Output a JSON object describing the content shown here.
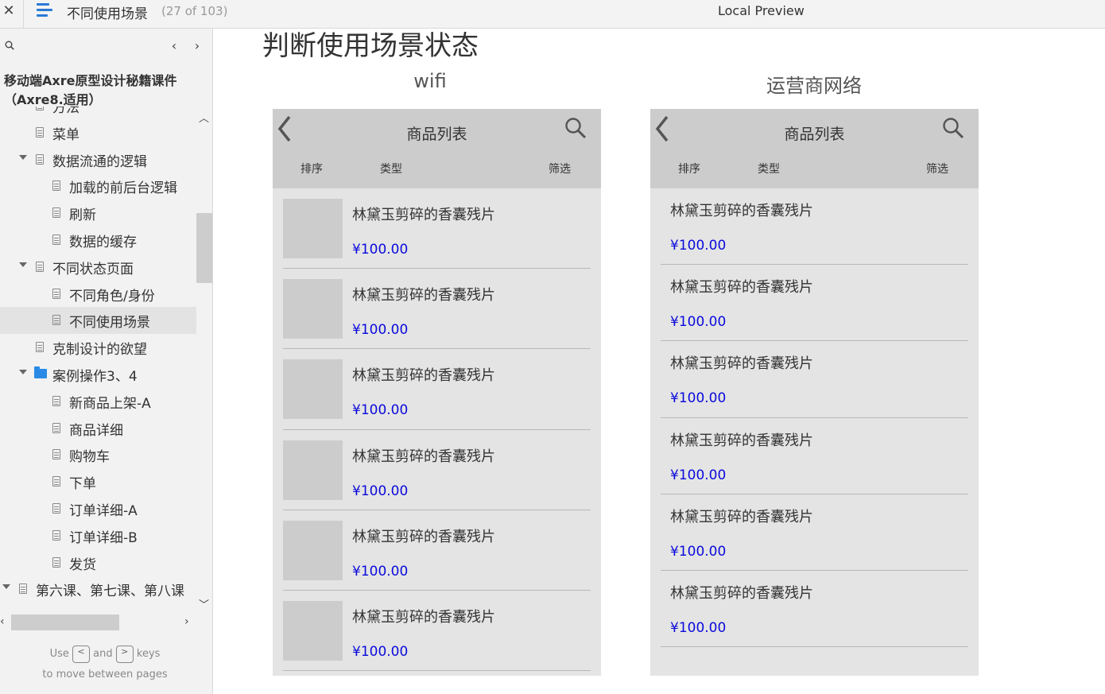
{
  "topbar": {
    "close": "✕",
    "page_title": "不同使用场景",
    "page_count": "(27 of 103)",
    "preview_label": "Local Preview"
  },
  "sidebar": {
    "prev": "‹",
    "next": "›",
    "project_title": "移动端Axre原型设计秘籍课件（Axre8.适用）",
    "tree": [
      {
        "label": "方法",
        "type": "page",
        "level": 1,
        "expanded": false,
        "selected": false
      },
      {
        "label": "菜单",
        "type": "page",
        "level": 1,
        "expanded": false,
        "selected": false
      },
      {
        "label": "数据流通的逻辑",
        "type": "page",
        "level": 1,
        "expanded": true,
        "selected": false
      },
      {
        "label": "加载的前后台逻辑",
        "type": "page",
        "level": 2,
        "expanded": false,
        "selected": false
      },
      {
        "label": "刷新",
        "type": "page",
        "level": 2,
        "expanded": false,
        "selected": false
      },
      {
        "label": "数据的缓存",
        "type": "page",
        "level": 2,
        "expanded": false,
        "selected": false
      },
      {
        "label": "不同状态页面",
        "type": "page",
        "level": 1,
        "expanded": true,
        "selected": false
      },
      {
        "label": "不同角色/身份",
        "type": "page",
        "level": 2,
        "expanded": false,
        "selected": false
      },
      {
        "label": "不同使用场景",
        "type": "page",
        "level": 2,
        "expanded": false,
        "selected": true
      },
      {
        "label": "克制设计的欲望",
        "type": "page",
        "level": 1,
        "expanded": false,
        "selected": false
      },
      {
        "label": "案例操作3、4",
        "type": "folder",
        "level": 1,
        "expanded": true,
        "selected": false
      },
      {
        "label": "新商品上架-A",
        "type": "page",
        "level": 2,
        "expanded": false,
        "selected": false
      },
      {
        "label": "商品详细",
        "type": "page",
        "level": 2,
        "expanded": false,
        "selected": false
      },
      {
        "label": "购物车",
        "type": "page",
        "level": 2,
        "expanded": false,
        "selected": false
      },
      {
        "label": "下单",
        "type": "page",
        "level": 2,
        "expanded": false,
        "selected": false
      },
      {
        "label": "订单详细-A",
        "type": "page",
        "level": 2,
        "expanded": false,
        "selected": false
      },
      {
        "label": "订单详细-B",
        "type": "page",
        "level": 2,
        "expanded": false,
        "selected": false
      },
      {
        "label": "发货",
        "type": "page",
        "level": 2,
        "expanded": false,
        "selected": false
      },
      {
        "label": "第六课、第七课、第八课",
        "type": "page",
        "level": 0,
        "expanded": true,
        "selected": false
      }
    ],
    "hint": {
      "use": "Use",
      "key_prev": "<",
      "and": "and",
      "key_next": ">",
      "keys": "keys",
      "line2": "to move between pages"
    }
  },
  "main": {
    "heading": "判断使用场景状态",
    "columns": [
      {
        "title": "wifi",
        "with_thumbs": true
      },
      {
        "title": "运营商网络",
        "with_thumbs": false
      }
    ],
    "phone": {
      "title": "商品列表",
      "tabs": [
        "排序",
        "类型",
        "筛选"
      ],
      "item_name": "林黛玉剪碎的香囊残片",
      "item_price": "¥100.00"
    }
  },
  "colors": {
    "accent": "#2a7ad6",
    "price": "#0a0adc",
    "phone_header": "#cccccc",
    "phone_body": "#e4e4e4"
  }
}
